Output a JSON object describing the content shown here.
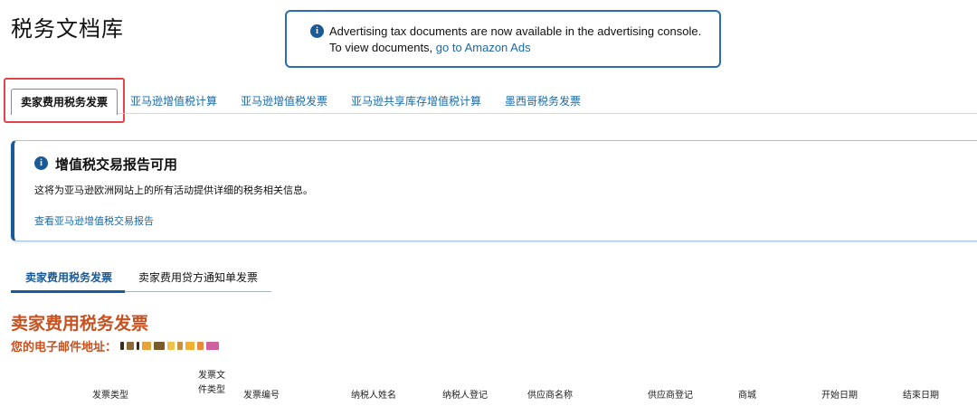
{
  "page": {
    "title": "税务文档库"
  },
  "top_alert": {
    "line1": "Advertising tax documents are now available in the advertising console.",
    "line2_prefix": "To view documents, ",
    "line2_link": "go to Amazon Ads"
  },
  "tabs": [
    {
      "label": "卖家费用税务发票",
      "active": true
    },
    {
      "label": "亚马逊增值税计算",
      "active": false
    },
    {
      "label": "亚马逊增值税发票",
      "active": false
    },
    {
      "label": "亚马逊共享库存增值税计算",
      "active": false
    },
    {
      "label": "墨西哥税务发票",
      "active": false
    }
  ],
  "vat_notice": {
    "title": "增值税交易报告可用",
    "description": "这将为亚马逊欧洲网站上的所有活动提供详细的税务相关信息。",
    "link": "查看亚马逊增值税交易报告"
  },
  "subtabs": [
    {
      "label": "卖家费用税务发票",
      "active": true
    },
    {
      "label": "卖家费用贷方通知单发票",
      "active": false
    }
  ],
  "section": {
    "title": "卖家费用税务发票",
    "email_label": "您的电子邮件地址："
  },
  "table": {
    "columns": [
      {
        "label": "发票类型"
      },
      {
        "label_line1": "发票文",
        "label_line2": "件类型"
      },
      {
        "label": "发票编号"
      },
      {
        "label": "纳税人姓名"
      },
      {
        "label": "纳税人登记"
      },
      {
        "label": "供应商名称"
      },
      {
        "label": "供应商登记"
      },
      {
        "label": "商城"
      },
      {
        "label": "开始日期"
      },
      {
        "label": "结束日期"
      }
    ]
  },
  "colors": {
    "link": "#1a6aa8",
    "accent_blue": "#1a5a96",
    "section_orange": "#c7511f",
    "highlight_red": "#e0454a"
  }
}
